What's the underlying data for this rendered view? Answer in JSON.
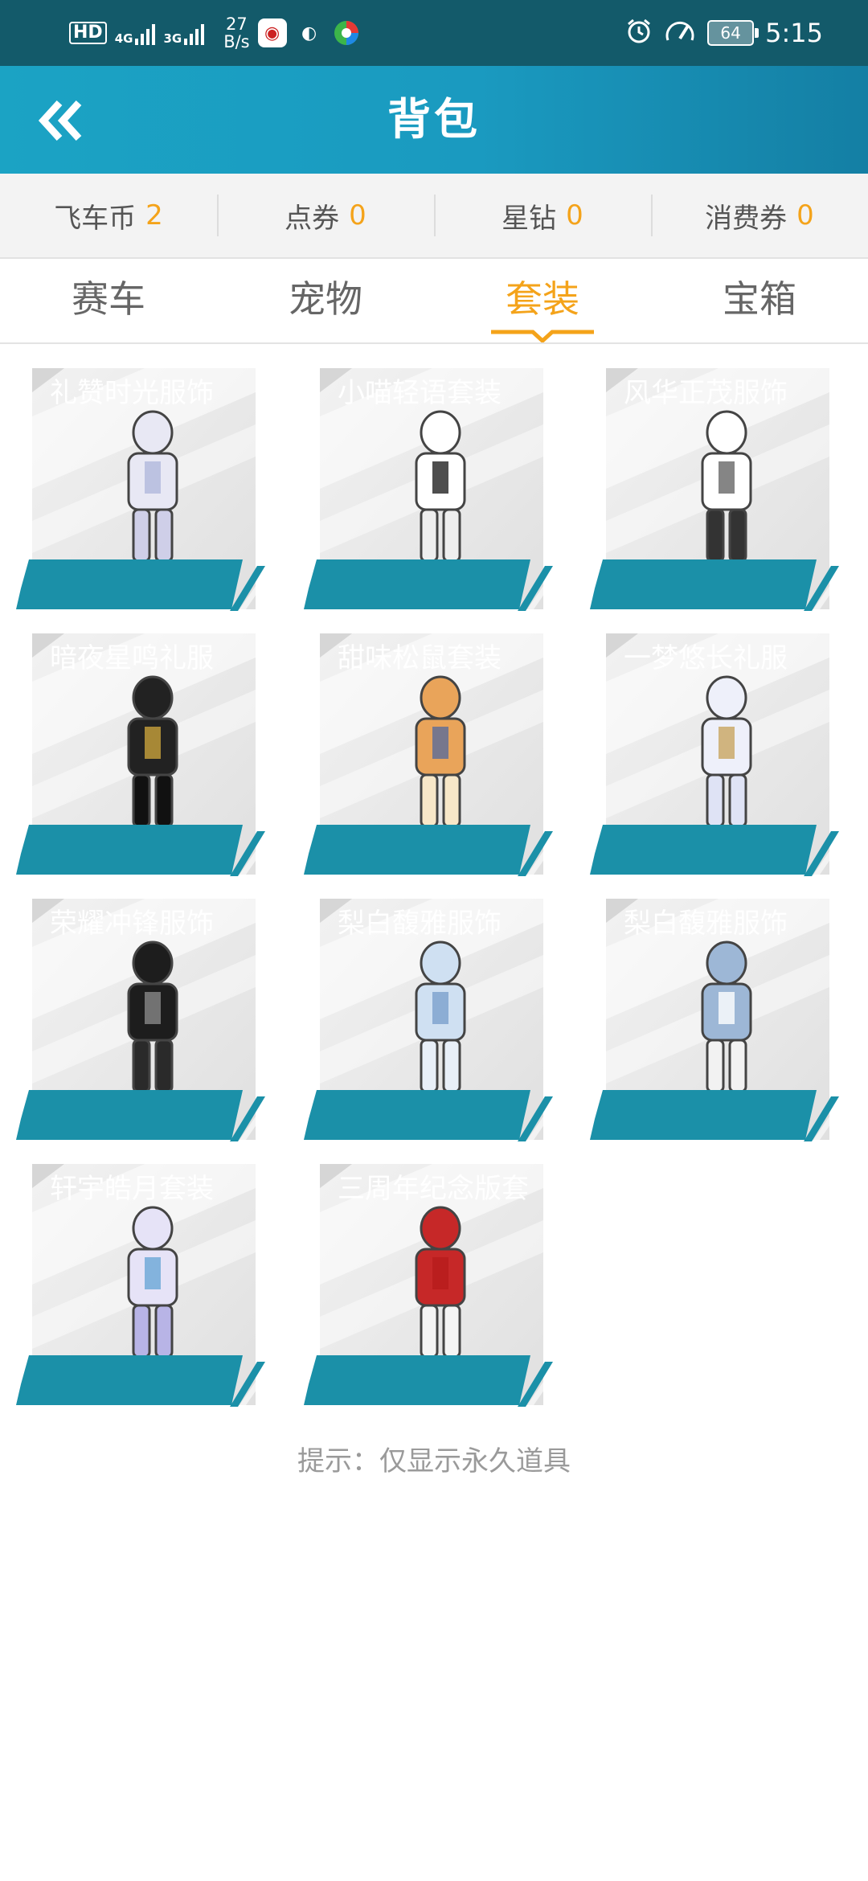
{
  "status_bar": {
    "hd": "HD",
    "net1": "4G",
    "net2": "3G",
    "speed_value": "27",
    "speed_unit": "B/s",
    "battery": "64",
    "time": "5:15"
  },
  "header": {
    "title": "背包"
  },
  "currencies": [
    {
      "label": "飞车币",
      "value": "2"
    },
    {
      "label": "点券",
      "value": "0"
    },
    {
      "label": "星钻",
      "value": "0"
    },
    {
      "label": "消费券",
      "value": "0"
    }
  ],
  "tabs": [
    {
      "label": "赛车"
    },
    {
      "label": "宠物"
    },
    {
      "label": "套装"
    },
    {
      "label": "宝箱"
    }
  ],
  "items": [
    {
      "name": "礼赞时光服饰"
    },
    {
      "name": "小喵轻语套装"
    },
    {
      "name": "风华正茂服饰"
    },
    {
      "name": "暗夜星鸣礼服"
    },
    {
      "name": "甜味松鼠套装"
    },
    {
      "name": "一梦悠长礼服"
    },
    {
      "name": "荣耀冲锋服饰"
    },
    {
      "name": "梨白馥雅服饰"
    },
    {
      "name": "梨白馥雅服饰"
    },
    {
      "name": "轩宇皓月套装"
    },
    {
      "name": "三周年纪念版套装"
    }
  ],
  "tip": "提示：仅显示永久道具",
  "colors": {
    "accent": "#f4a31a",
    "header": "#1a9ac0",
    "label": "#1b90a8"
  }
}
